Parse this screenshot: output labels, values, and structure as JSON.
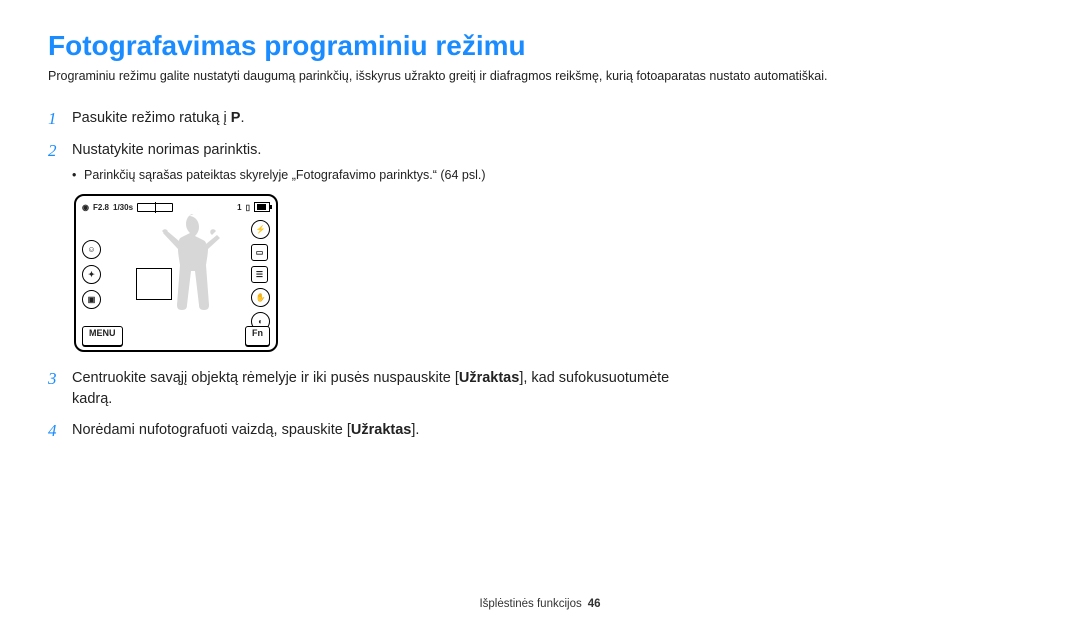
{
  "title": "Fotografavimas programiniu režimu",
  "intro": "Programiniu režimu galite nustatyti daugumą parinkčių, išskyrus užrakto greitį ir diafragmos reikšmę, kurią fotoaparatas nustato automatiškai.",
  "steps": {
    "s1_text": "Pasukite režimo ratuką į ",
    "s1_icon": "P",
    "s1_period": ".",
    "s2_text": "Nustatykite norimas parinktis.",
    "s2_sub": "Parinkčių sąrašas pateiktas skyrelyje „Fotografavimo parinktys.“ (64 psl.)",
    "s3_pre": "Centruokite savąjį objektą rėmelyje ir iki pusės nuspauskite [",
    "s3_bold": "Užraktas",
    "s3_post": "], kad sufokusuotumėte kadrą.",
    "s4_pre": "Norėdami nufotografuoti vaizdą, spauskite [",
    "s4_bold": "Užraktas",
    "s4_post": "]."
  },
  "step_numbers": {
    "s1": "1",
    "s2": "2",
    "s3": "3",
    "s4": "4"
  },
  "lcd": {
    "aperture": "F2.8",
    "shutter": "1/30s",
    "count": "1",
    "menu": "MENU",
    "fn": "Fn"
  },
  "footer": {
    "section": "Išplėstinės funkcijos",
    "page": "46"
  }
}
